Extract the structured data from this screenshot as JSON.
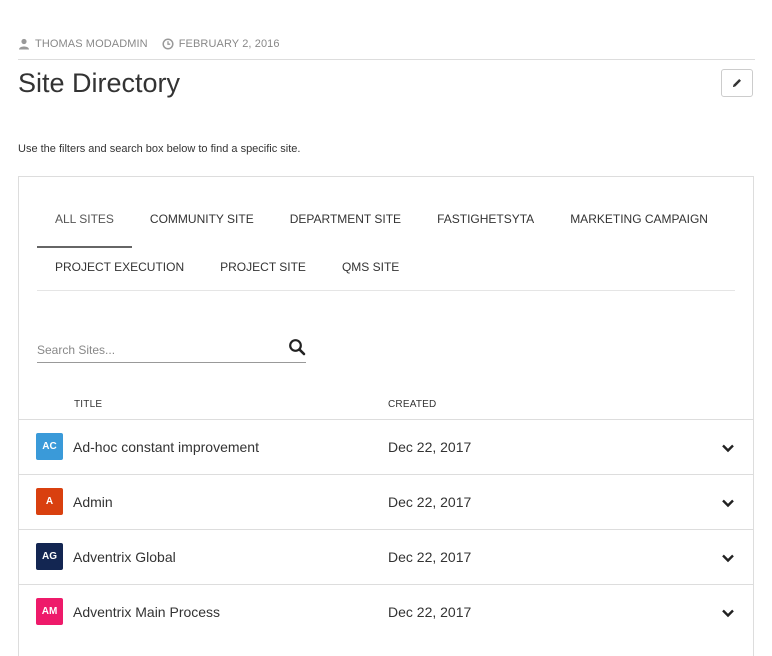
{
  "meta": {
    "author": "THOMAS MODADMIN",
    "date": "FEBRUARY 2, 2016"
  },
  "page": {
    "title": "Site Directory",
    "intro": "Use the filters and search box below to find a specific site.",
    "edit_icon": "pencil-icon"
  },
  "tabs": [
    {
      "label": "ALL SITES",
      "active": true
    },
    {
      "label": "COMMUNITY SITE"
    },
    {
      "label": "DEPARTMENT SITE"
    },
    {
      "label": "FASTIGHETSYTA"
    },
    {
      "label": "MARKETING CAMPAIGN"
    },
    {
      "label": "PROJECT EXECUTION"
    },
    {
      "label": "PROJECT SITE"
    },
    {
      "label": "QMS SITE"
    }
  ],
  "search": {
    "placeholder": "Search Sites...",
    "icon": "search-icon"
  },
  "columns": {
    "title": "TITLE",
    "created": "CREATED"
  },
  "rows": [
    {
      "initials": "AC",
      "color": "#3a9ad9",
      "title": "Ad-hoc constant improvement",
      "created": "Dec 22, 2017"
    },
    {
      "initials": "A",
      "color": "#d9400f",
      "title": "Admin",
      "created": "Dec 22, 2017"
    },
    {
      "initials": "AG",
      "color": "#132652",
      "title": "Adventrix Global",
      "created": "Dec 22, 2017"
    },
    {
      "initials": "AM",
      "color": "#ee1a6a",
      "title": "Adventrix Main Process",
      "created": "Dec 22, 2017"
    }
  ]
}
